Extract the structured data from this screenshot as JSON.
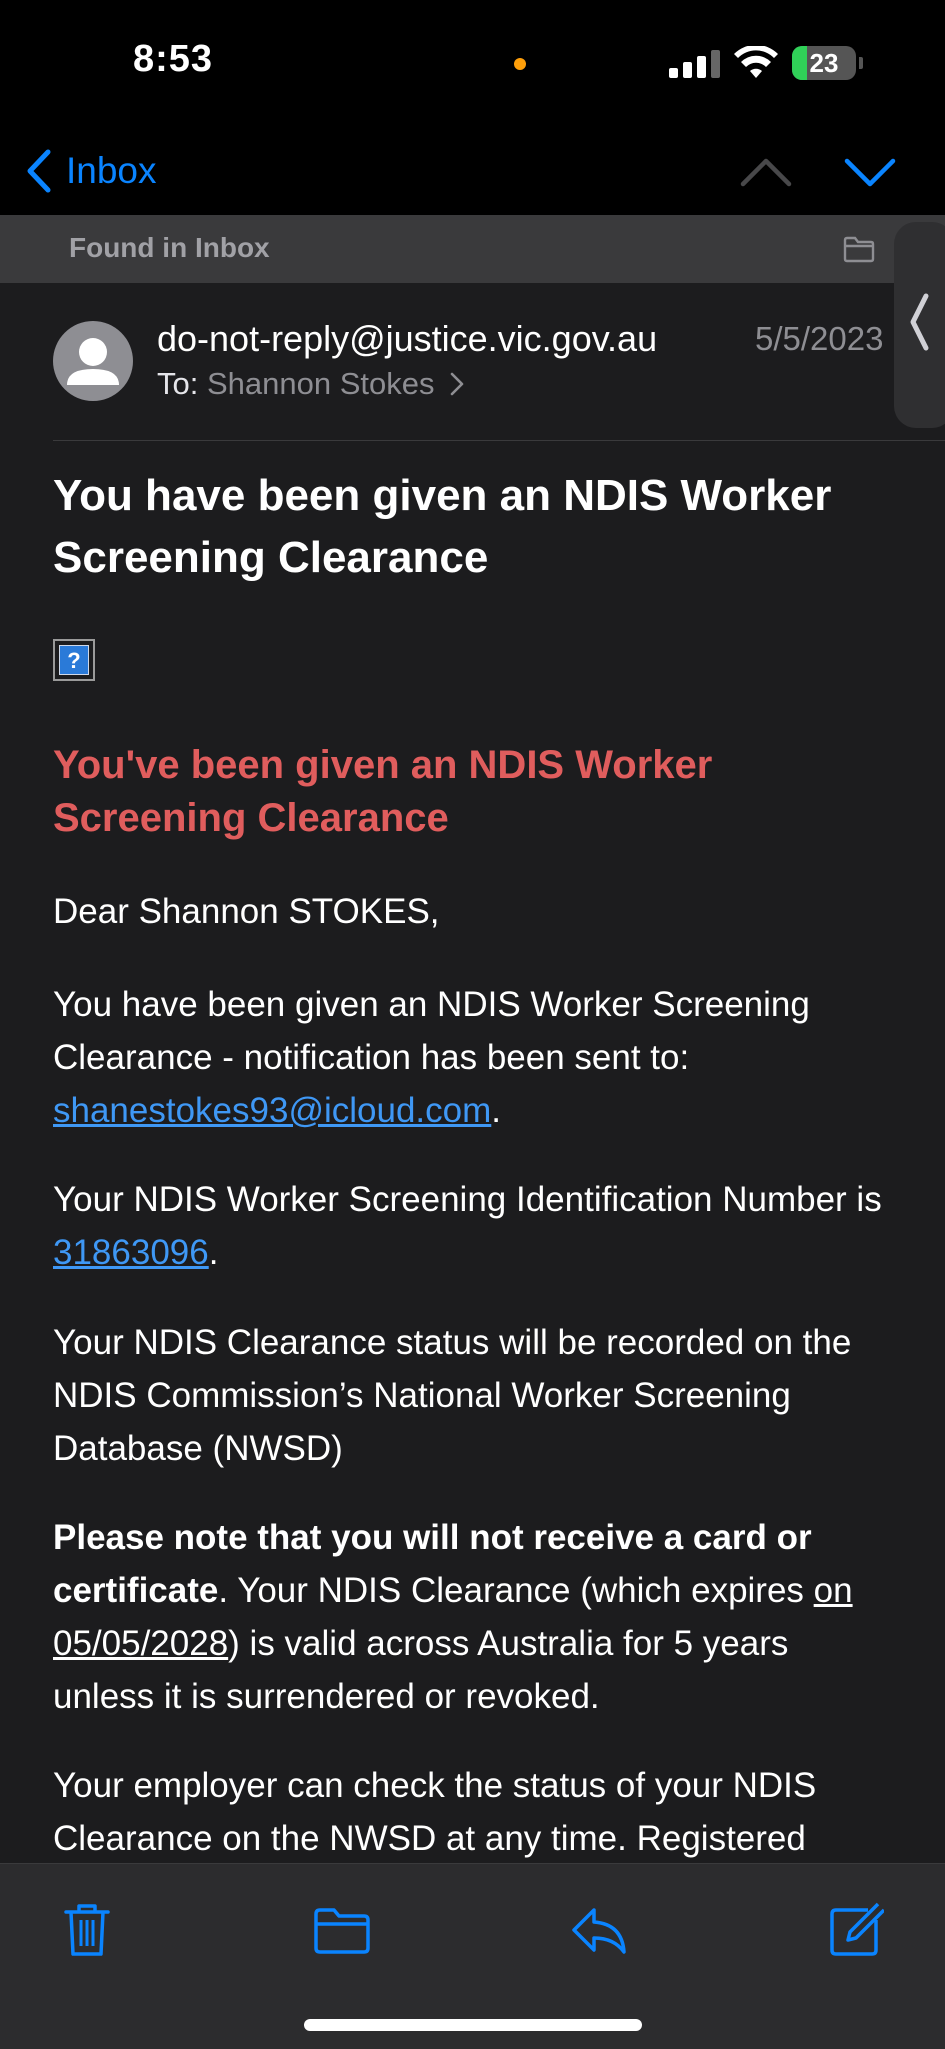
{
  "status_bar": {
    "time": "8:53",
    "battery_level": "23",
    "battery_fraction": 0.23,
    "accent_orange": "#ff9f0a"
  },
  "nav": {
    "back_label": "Inbox",
    "back_icon": "chevron-left-icon",
    "prev_icon": "chevron-up-icon",
    "next_icon": "chevron-down-icon"
  },
  "location_banner": {
    "text": "Found in Inbox",
    "icon": "folder-icon"
  },
  "message": {
    "sender": "do-not-reply@justice.vic.gov.au",
    "date": "5/5/2023",
    "to_label": "To:",
    "recipient": "Shannon Stokes",
    "subject": "You have been given an NDIS Worker Screening Clearance",
    "image_placeholder": "?",
    "heading": "You've been given an NDIS Worker Screening Clearance",
    "greeting": "Dear Shannon STOKES,",
    "p1_text": "You have been given an NDIS Worker Screening Clearance - notification has been sent to: ",
    "p1_email": "shanestokes93@icloud.com",
    "p1_end": ".",
    "p2_text": "Your NDIS Worker Screening Identification Number is ",
    "p2_number": "31863096",
    "p2_end": ".",
    "p3_text": "Your NDIS Clearance status will be recorded on the NDIS Commission’s National Worker Screening Database (NWSD)",
    "p4_bold": "Please note that you will not receive a card or certificate",
    "p4_text_a": ". Your NDIS Clearance (which expires ",
    "p4_expiry": "on 05/05/2028",
    "p4_text_b": ") is valid across Australia for 5 years unless it is surrendered or revoked.",
    "p5_text": "Your employer can check the status of your NDIS Clearance on the NWSD at any time. Registered"
  },
  "toolbar": {
    "trash_icon": "trash-icon",
    "folder_icon": "folder-icon",
    "reply_icon": "reply-icon",
    "compose_icon": "compose-icon"
  },
  "colors": {
    "accent": "#0a84ff",
    "heading_red": "#e05d5d",
    "link": "#3f98f5",
    "background": "#1c1c1e"
  }
}
